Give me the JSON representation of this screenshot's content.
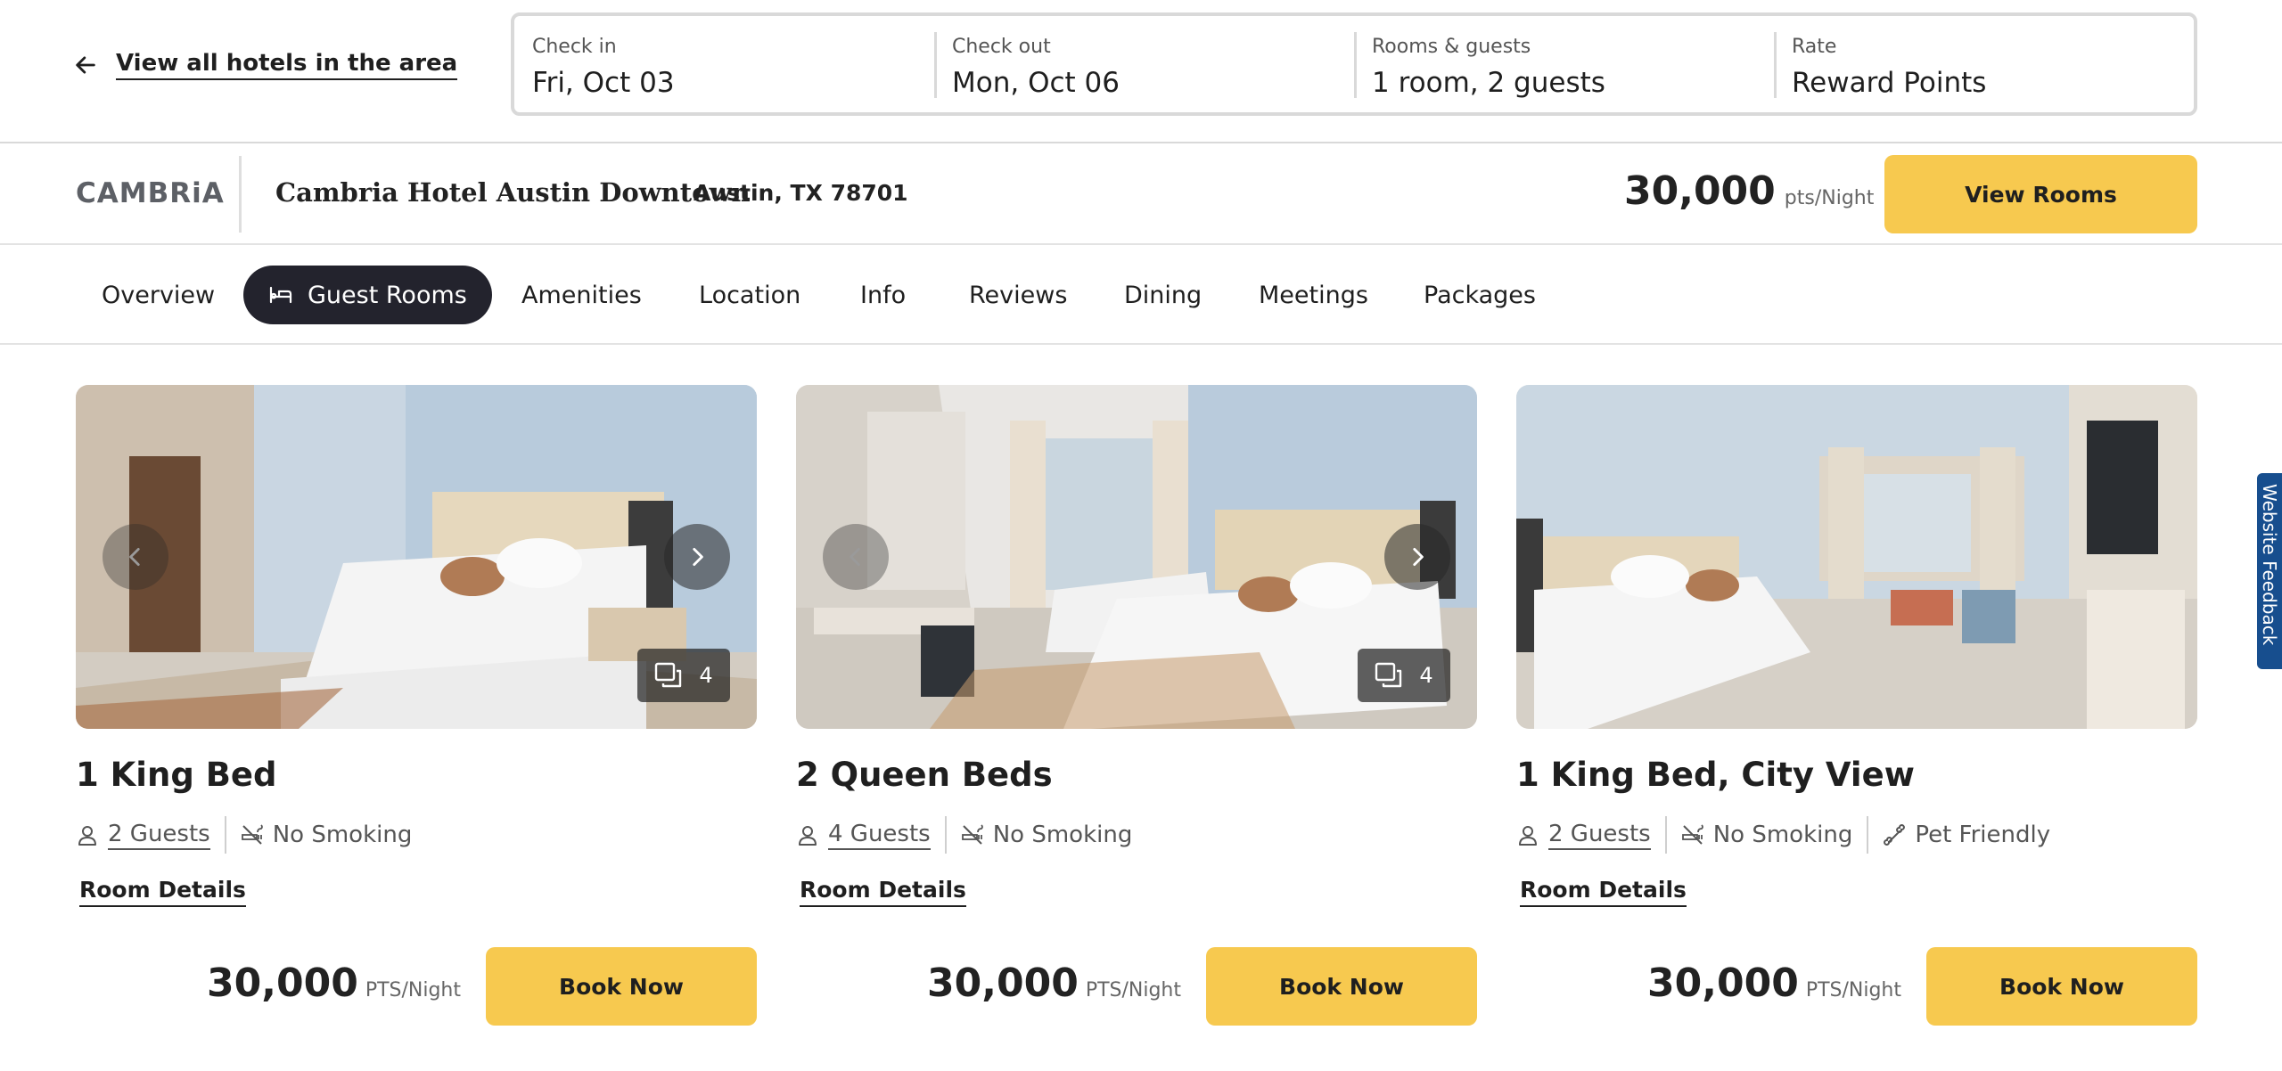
{
  "header": {
    "back_link": "View all hotels in the area",
    "search": [
      {
        "caption": "Check in",
        "value": "Fri, Oct 03"
      },
      {
        "caption": "Check out",
        "value": "Mon, Oct 06"
      },
      {
        "caption": "Rooms & guests",
        "value": "1 room, 2 guests"
      },
      {
        "caption": "Rate",
        "value": "Reward Points"
      }
    ]
  },
  "hotel": {
    "brand": "CAMBRiA",
    "name": "Cambria Hotel Austin Downtown",
    "city": "Austin, TX 78701",
    "price": "30,000",
    "price_unit": "pts/Night",
    "view_rooms_label": "View Rooms"
  },
  "tabs": [
    {
      "label": "Overview",
      "active": false
    },
    {
      "label": "Guest Rooms",
      "active": true
    },
    {
      "label": "Amenities",
      "active": false
    },
    {
      "label": "Location",
      "active": false
    },
    {
      "label": "Info",
      "active": false
    },
    {
      "label": "Reviews",
      "active": false
    },
    {
      "label": "Dining",
      "active": false
    },
    {
      "label": "Meetings",
      "active": false
    },
    {
      "label": "Packages",
      "active": false
    }
  ],
  "rooms": [
    {
      "title": "1 King Bed",
      "guests": "2 Guests",
      "smoking": "No Smoking",
      "pet": "",
      "photo_count": "4",
      "details_label": "Room Details",
      "price": "30,000",
      "price_unit": "PTS/Night",
      "book_label": "Book Now"
    },
    {
      "title": "2 Queen Beds",
      "guests": "4 Guests",
      "smoking": "No Smoking",
      "pet": "",
      "photo_count": "4",
      "details_label": "Room Details",
      "price": "30,000",
      "price_unit": "PTS/Night",
      "book_label": "Book Now"
    },
    {
      "title": "1 King Bed, City View",
      "guests": "2 Guests",
      "smoking": "No Smoking",
      "pet": "Pet Friendly",
      "photo_count": "",
      "details_label": "Room Details",
      "price": "30,000",
      "price_unit": "PTS/Night",
      "book_label": "Book Now"
    }
  ],
  "feedback_label": "Website Feedback",
  "colors": {
    "accent_yellow": "#f7c94f",
    "active_tab": "#23232d",
    "feedback_blue": "#174e8e",
    "border_gray": "#d9d9d9"
  }
}
